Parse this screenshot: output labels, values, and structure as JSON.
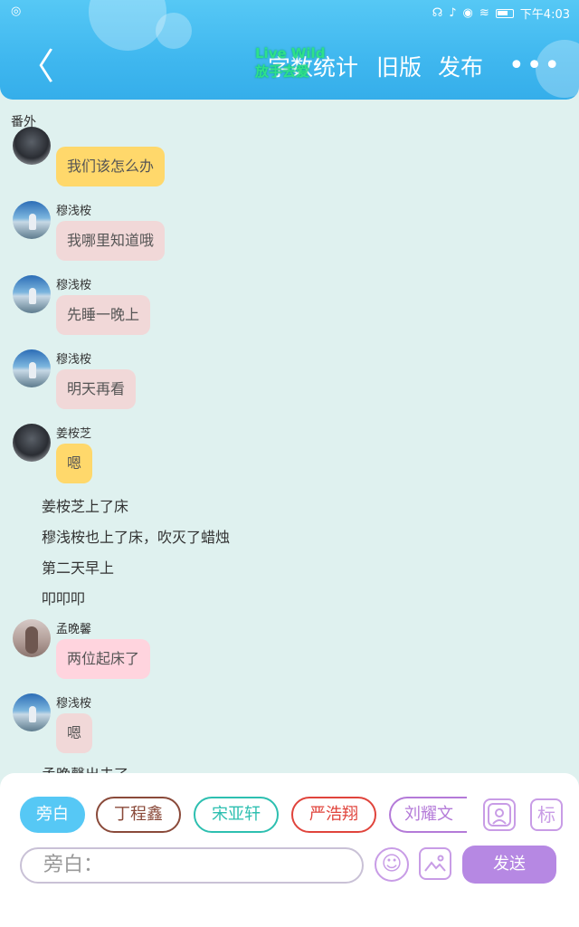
{
  "status": {
    "time": "下午4:03",
    "left_icon": "app-icon"
  },
  "header": {
    "back_glyph": "〈",
    "buttons": [
      "字数统计",
      "旧版",
      "发布"
    ],
    "more_glyph": "•••",
    "watermark_1": "Live Wild",
    "watermark_2": "放手去爱"
  },
  "chat": {
    "chapter": "番外",
    "messages": [
      {
        "name": "",
        "text": "我们该怎么办"
      },
      {
        "name": "穆浅桉",
        "text": "我哪里知道哦"
      },
      {
        "name": "穆浅桉",
        "text": "先睡一晚上"
      },
      {
        "name": "穆浅桉",
        "text": "明天再看"
      },
      {
        "name": "姜桉芝",
        "text": "嗯"
      },
      {
        "name": "孟晚馨",
        "text": "两位起床了"
      },
      {
        "name": "穆浅桉",
        "text": "嗯"
      }
    ],
    "narration": [
      "姜桉芝上了床",
      "穆浅桉也上了床，吹灭了蜡烛",
      "第二天早上",
      "叩叩叩",
      "孟晚馨出去了"
    ]
  },
  "panel": {
    "chips": [
      {
        "label": "旁白",
        "color": "#56c8f5"
      },
      {
        "label": "丁程鑫",
        "color": "#8a4a3a"
      },
      {
        "label": "宋亚轩",
        "color": "#2dbfb0"
      },
      {
        "label": "严浩翔",
        "color": "#e0443c"
      },
      {
        "label": "刘耀文",
        "color": "#b47ad8"
      }
    ],
    "tag_label": "标",
    "input_placeholder": "旁白：",
    "send_label": "发送"
  }
}
